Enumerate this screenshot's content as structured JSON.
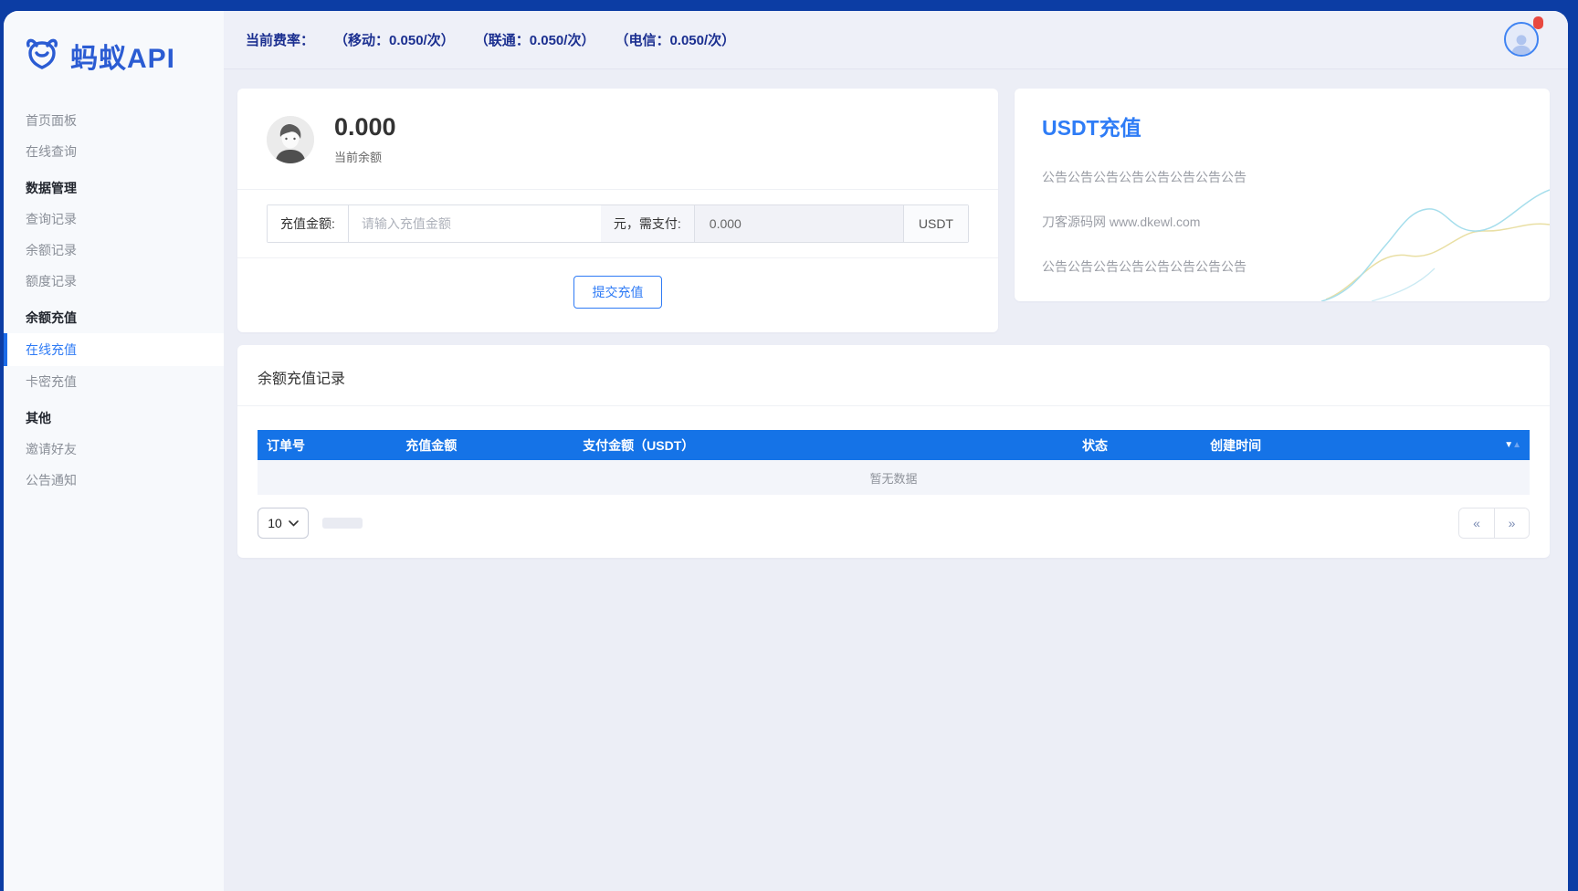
{
  "logo": {
    "text": "蚂蚁API"
  },
  "topbar": {
    "rate_label": "当前费率：",
    "rates": [
      "（移动：0.050/次）",
      "（联通：0.050/次）",
      "（电信：0.050/次）"
    ]
  },
  "sidebar": {
    "items": [
      {
        "label": "首页面板",
        "type": "link"
      },
      {
        "label": "在线查询",
        "type": "link"
      },
      {
        "label": "数据管理",
        "type": "section"
      },
      {
        "label": "查询记录",
        "type": "link"
      },
      {
        "label": "余额记录",
        "type": "link"
      },
      {
        "label": "额度记录",
        "type": "link"
      },
      {
        "label": "余额充值",
        "type": "section"
      },
      {
        "label": "在线充值",
        "type": "link",
        "active": true
      },
      {
        "label": "卡密充值",
        "type": "link"
      },
      {
        "label": "其他",
        "type": "section"
      },
      {
        "label": "邀请好友",
        "type": "link"
      },
      {
        "label": "公告通知",
        "type": "link"
      }
    ]
  },
  "balance_card": {
    "amount": "0.000",
    "label": "当前余额",
    "form": {
      "amount_label": "充值金额:",
      "amount_placeholder": "请输入充值金额",
      "amount_value": "",
      "pay_label": "元，需支付:",
      "pay_value": "0.000",
      "currency": "USDT"
    },
    "submit_label": "提交充值"
  },
  "usdt_card": {
    "title": "USDT充值",
    "lines": [
      "公告公告公告公告公告公告公告公告",
      "刀客源码网 www.dkewl.com",
      "公告公告公告公告公告公告公告公告"
    ]
  },
  "records_card": {
    "title": "余额充值记录",
    "table": {
      "columns": [
        "订单号",
        "充值金额",
        "支付金额（USDT）",
        "状态",
        "创建时间"
      ],
      "sort_desc_icon": "▼",
      "sort_asc_icon": "▲",
      "empty_text": "暂无数据"
    },
    "pagination": {
      "page_size": "10",
      "prev_icon": "«",
      "next_icon": "»"
    }
  },
  "colors": {
    "frame_blue": "#0C3DA4",
    "table_header_blue": "#1573E7",
    "accent_blue": "#2F7BF5",
    "logo_blue": "#2B5CD3",
    "rate_text": "#1B2F90",
    "badge_red": "#E8483F",
    "wave_cyan": "#A6DEEC",
    "wave_yellow": "#E9DFA4"
  }
}
